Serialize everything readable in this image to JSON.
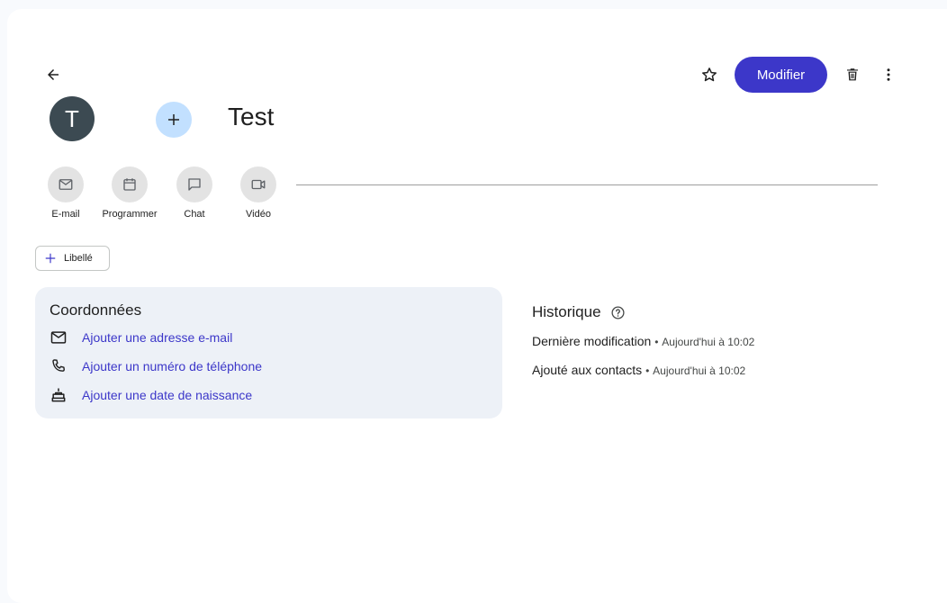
{
  "contact": {
    "avatar_letter": "T",
    "name": "Test"
  },
  "toolbar": {
    "back_icon": "arrow-back-icon",
    "star_icon": "star-outline-icon",
    "modify_label": "Modifier",
    "delete_icon": "trash-icon",
    "more_icon": "more-vert-icon"
  },
  "actions": [
    {
      "label": "E-mail",
      "icon": "mail-icon"
    },
    {
      "label": "Programmer",
      "icon": "calendar-icon"
    },
    {
      "label": "Chat",
      "icon": "chat-icon"
    },
    {
      "label": "Vidéo",
      "icon": "video-icon"
    }
  ],
  "label_button": {
    "label": "Libellé"
  },
  "coordinates": {
    "title": "Coordonnées",
    "items": [
      {
        "label": "Ajouter une adresse e-mail",
        "icon": "mail-icon"
      },
      {
        "label": "Ajouter un numéro de téléphone",
        "icon": "phone-icon"
      },
      {
        "label": "Ajouter une date de naissance",
        "icon": "cake-icon"
      }
    ]
  },
  "history": {
    "title": "Historique",
    "help_icon": "help-icon",
    "rows": [
      {
        "label": "Dernière modification",
        "separator": "•",
        "time": "Aujourd'hui à 10:02"
      },
      {
        "label": "Ajouté aux contacts",
        "separator": "•",
        "time": "Aujourd'hui à 10:02"
      }
    ]
  },
  "colors": {
    "accent": "#3c37c9",
    "avatar_bg": "#3c4a52",
    "add_photo_bg": "#c2e0ff",
    "card_bg": "#edf1f7"
  }
}
